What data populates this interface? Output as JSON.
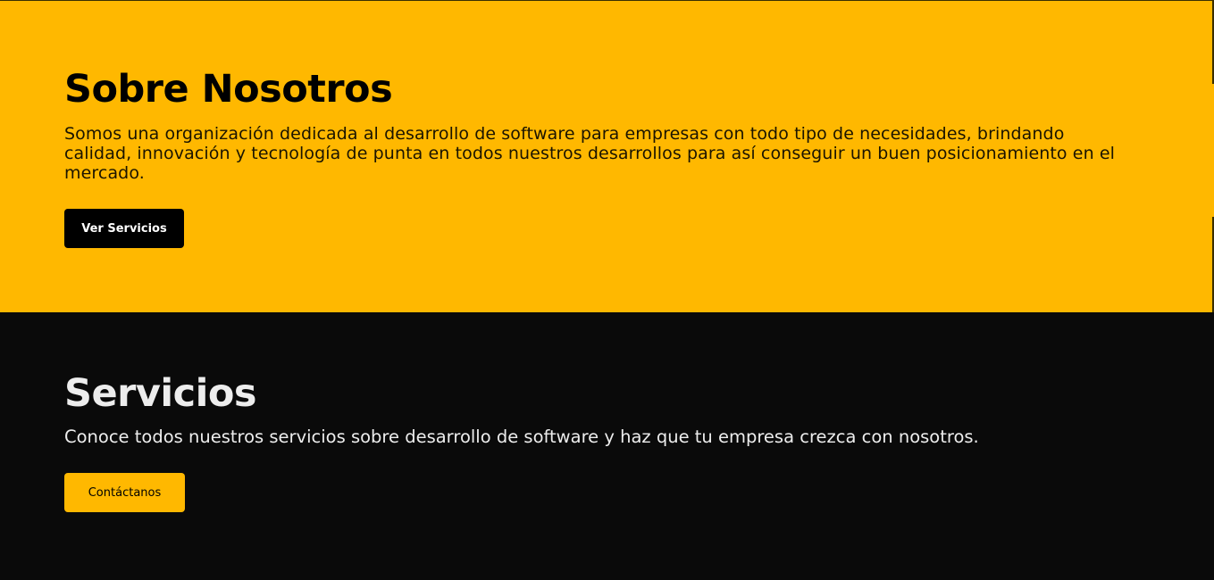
{
  "about": {
    "title": "Sobre Nosotros",
    "description": "Somos una organización dedicada al desarrollo de software para empresas con todo tipo de necesidades, brindando calidad, innovación y tecnología de punta en todos nuestros desarrollos para así conseguir un buen posicionamiento en el mercado.",
    "button_label": "Ver Servicios",
    "background_color": "#FFB800"
  },
  "services": {
    "title": "Servicios",
    "description": "Conoce todos nuestros servicios sobre desarrollo de software y haz que tu empresa crezca con nosotros.",
    "button_label": "Contáctanos",
    "background_color": "#0A0A0A"
  },
  "colors": {
    "accent": "#FFB800",
    "dark": "#000000",
    "light_text": "#EDEDED"
  }
}
